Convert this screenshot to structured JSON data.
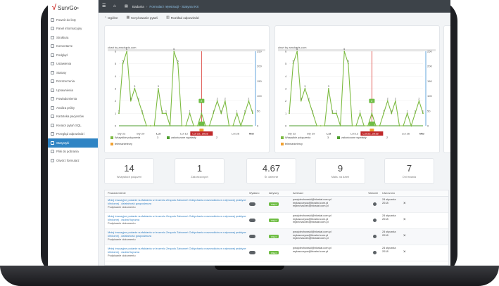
{
  "logo": {
    "brand": "SurvGo",
    "tm": "®"
  },
  "sidebar": {
    "items": [
      {
        "label": "Powrót do listy",
        "icon": "arrow-left-icon"
      },
      {
        "label": "Panel informacyjny",
        "icon": "dashboard-icon"
      },
      {
        "label": "Struktura",
        "icon": "structure-icon"
      },
      {
        "label": "Komentarze",
        "icon": "comment-icon"
      },
      {
        "label": "Podgląd",
        "icon": "eye-icon"
      },
      {
        "label": "Ustawienia",
        "icon": "gear-icon"
      },
      {
        "label": "Statusy",
        "icon": "flag-icon"
      },
      {
        "label": "Rozszerzenia",
        "icon": "puzzle-icon"
      },
      {
        "label": "Uprawnienia",
        "icon": "lock-icon"
      },
      {
        "label": "Powiadomienia",
        "icon": "bell-icon"
      },
      {
        "label": "Analiza próby",
        "icon": "analysis-icon"
      },
      {
        "label": "Kartoteka pacjentów",
        "icon": "folder-icon"
      },
      {
        "label": "Kreator pytań SQL",
        "icon": "database-icon"
      },
      {
        "label": "Przegląd odpowiedzi",
        "icon": "list-icon"
      },
      {
        "label": "Statystyki",
        "icon": "chart-icon",
        "active": true
      },
      {
        "label": "Pliki do pobrania",
        "icon": "download-icon"
      },
      {
        "label": "Otwórz formularz",
        "icon": "external-icon"
      }
    ]
  },
  "topbar": {
    "crumb1": "Badania",
    "crumb2": "Formularz rejestracji - Statyna IKS"
  },
  "tabs": [
    {
      "label": "Ogólne",
      "icon": "pie-icon"
    },
    {
      "label": "Krzyżowanie pytań",
      "icon": "grid-icon"
    },
    {
      "label": "Rozkład odpowiedzi",
      "icon": "bar-icon"
    }
  ],
  "chart_data": [
    {
      "type": "line",
      "credit": "chart by amcharts.com",
      "x_ticks": [
        "Sty 22",
        "Sty 29",
        "Lut",
        "Lut 12",
        "Lut 22, 2018",
        "Lut 26",
        "Mar"
      ],
      "y_left": [
        0,
        1,
        2,
        3,
        4,
        5,
        6
      ],
      "y_right": [
        0,
        50,
        100,
        150,
        200,
        250
      ],
      "series": [
        {
          "name": "Wszystkie połączenia",
          "total": "3",
          "color": "#7dbb42",
          "values": [
            1,
            5,
            6,
            2,
            3,
            2,
            1,
            0,
            0,
            0,
            3,
            1,
            1,
            0,
            6,
            5,
            0,
            0,
            1,
            0,
            0,
            1,
            0,
            0,
            1,
            2,
            1,
            2,
            0,
            0,
            1,
            0,
            1,
            2,
            1
          ]
        },
        {
          "name": "zakończone wywiady",
          "total": "2",
          "color": "#4d9e2e",
          "values": [
            0,
            0,
            0,
            0,
            0,
            0,
            0,
            0,
            0,
            0,
            0,
            0,
            0,
            0,
            0,
            0,
            0,
            0,
            0,
            0,
            0,
            0,
            0,
            0,
            0,
            0,
            0,
            0,
            0,
            0,
            0,
            0,
            0,
            0,
            0
          ]
        },
        {
          "name": "telemarketerzy",
          "total": "",
          "color": "#f0a030",
          "values": []
        }
      ],
      "cursor_label": "Lut 22, 2018",
      "balloon": "2"
    },
    {
      "type": "line",
      "credit": "chart by amcharts.com",
      "x_ticks": [
        "Sty 22",
        "Sty 29",
        "Lut",
        "Lut 12",
        "Lut 22, 2018",
        "Lut 26",
        "Mar"
      ],
      "y_left": [
        0,
        1,
        2,
        3,
        4,
        5,
        6
      ],
      "y_right": [
        0,
        50,
        100,
        150,
        200,
        250
      ],
      "series": [
        {
          "name": "Wszystkie połączenia",
          "total": "3",
          "color": "#7dbb42",
          "values": [
            1,
            5,
            6,
            2,
            3,
            2,
            1,
            0,
            0,
            0,
            3,
            1,
            1,
            0,
            6,
            5,
            0,
            0,
            1,
            0,
            0,
            1,
            0,
            0,
            1,
            2,
            1,
            2,
            0,
            0,
            1,
            0,
            1,
            2,
            1
          ]
        },
        {
          "name": "zakończone wywiady",
          "total": "2",
          "color": "#4d9e2e",
          "values": [
            0,
            0,
            0,
            0,
            0,
            0,
            0,
            0,
            0,
            0,
            0,
            0,
            0,
            0,
            0,
            0,
            0,
            0,
            0,
            0,
            0,
            0,
            0,
            0,
            0,
            0,
            0,
            0,
            0,
            0,
            0,
            0,
            0,
            0,
            0
          ]
        },
        {
          "name": "telemarketerzy",
          "total": "",
          "color": "#f0a030",
          "values": []
        }
      ],
      "cursor_label": "Lut 22, 2018",
      "balloon": "2"
    }
  ],
  "stats": [
    {
      "value": "14",
      "label": "Wszystkich połączeń"
    },
    {
      "value": "1",
      "label": "Zakończonych"
    },
    {
      "value": "4.67",
      "label": "Śr. dziennie"
    },
    {
      "value": "9",
      "label": "Maks. na dzień"
    },
    {
      "value": "7",
      "label": "Dni trwania"
    }
  ],
  "table": {
    "headers": [
      "Powiadomienie",
      "Wysłano",
      "Aktywny",
      "Adresaci",
      "Warunki",
      "Utworzono"
    ],
    "rows": [
      {
        "title": "Mniej inwazyjne podanie surfaktantu w leczeniu Zespołu Zaburzeń Oddychania noworodków w rutynowej praktyce klinicznej - dziatalność gospodarcza",
        "sub": "Podpisanie dokumentu",
        "active": "Włącz",
        "to": [
          "pwojciechowski@biostat.com.pl",
          "mplaszczyca@biostat.com.pl",
          "mpiechaczek@biostat.com.pl"
        ],
        "date": [
          "24 stycznia",
          "2018"
        ]
      },
      {
        "title": "Mniej inwazyjne podanie surfaktantu w leczeniu Zespołu Zaburzeń Oddychania noworodków w rutynowej praktyce klinicznej - osoba fizyczna",
        "sub": "Podpisanie dokumentu",
        "active": "Włącz",
        "to": [
          "pwojciechowski@biostat.com.pl",
          "mplaszczyca@biostat.com.pl",
          "mpiechaczek@biostat.com.pl"
        ],
        "date": [
          "24 stycznia",
          "2018"
        ]
      },
      {
        "title": "Mniej inwazyjne podanie surfaktantu w leczeniu Zespołu Zaburzeń Oddychania noworodków w rutynowej praktyce klinicznej - dziatalność gospodarcza",
        "sub": "Podpisanie dokumentu",
        "active": "Włącz",
        "to": [
          "pwojciechowski@biostat.com.pl",
          "mplaszczyca@biostat.com.pl",
          "mpiechaczek@biostat.com.pl"
        ],
        "date": [
          "24 stycznia",
          "2018"
        ]
      },
      {
        "title": "Mniej inwazyjne podanie surfaktantu w leczeniu Zespołu Zaburzeń Oddychania noworodków w rutynowej praktyce klinicznej - osoba fizyczna",
        "sub": "Podpisanie dokumentu",
        "active": "Włącz",
        "to": [
          "pwojciechowski@biostat.com.pl",
          "mplaszczyca@biostat.com.pl"
        ],
        "date": [
          "24 stycznia",
          "2018"
        ]
      }
    ],
    "delete_glyph": "×"
  }
}
